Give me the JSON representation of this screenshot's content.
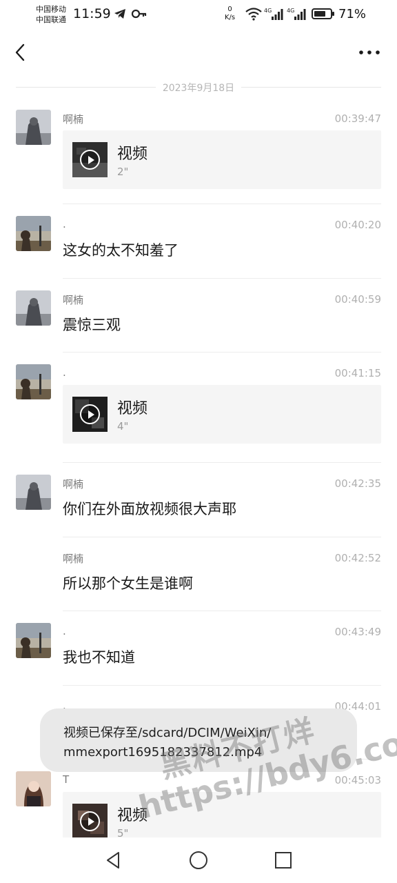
{
  "status_bar": {
    "carrier1": "中国移动",
    "carrier2": "中国联通",
    "time": "11:59",
    "speed_value": "0",
    "speed_unit": "K/s",
    "battery": "71%",
    "icons": [
      "telegram-icon",
      "key-icon",
      "wifi-icon",
      "signal-4g-icon",
      "signal-4g-icon",
      "battery-icon"
    ]
  },
  "header": {
    "back_icon": "chevron-left-icon",
    "more_icon": "more-dots-icon"
  },
  "date_divider": "2023年9月18日",
  "messages": [
    {
      "sender": "啊楠",
      "time": "00:39:47",
      "type": "video",
      "video_label": "视频",
      "duration": "2\""
    },
    {
      "sender": ".",
      "time": "00:40:20",
      "type": "text",
      "text": "这女的太不知羞了"
    },
    {
      "sender": "啊楠",
      "time": "00:40:59",
      "type": "text",
      "text": "震惊三观"
    },
    {
      "sender": ".",
      "time": "00:41:15",
      "type": "video",
      "video_label": "视频",
      "duration": "4\""
    },
    {
      "sender": "啊楠",
      "time": "00:42:35",
      "type": "text",
      "text": "你们在外面放视频很大声耶"
    },
    {
      "sender": "啊楠",
      "time": "00:42:52",
      "type": "text",
      "text": "所以那个女生是谁啊"
    },
    {
      "sender": ".",
      "time": "00:43:49",
      "type": "text",
      "text": "我也不知道"
    },
    {
      "sender": ".",
      "time": "00:44:01",
      "type": "text",
      "text": ""
    },
    {
      "sender": "T",
      "time": "00:45:03",
      "type": "video",
      "video_label": "视频",
      "duration": "5\""
    }
  ],
  "toast": {
    "line1": "视频已保存至/sdcard/DCIM/WeiXin/",
    "line2": "mmexport1695182337812.mp4"
  },
  "watermark": {
    "line1": "黑料不打烊",
    "line2": "https://bdy6.co"
  },
  "nav_bar": {
    "icons": [
      "back-triangle-icon",
      "home-circle-icon",
      "recents-square-icon"
    ]
  }
}
